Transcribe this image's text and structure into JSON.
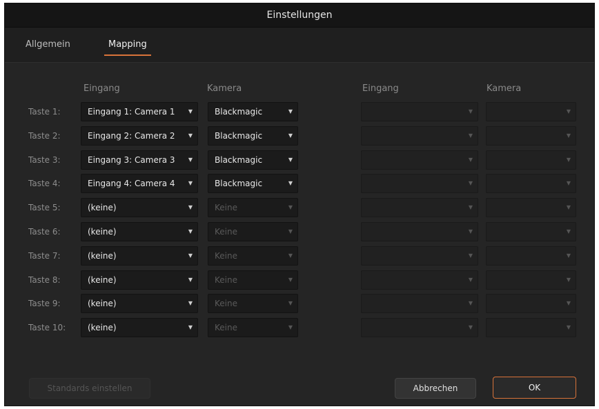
{
  "dialog": {
    "title": "Einstellungen"
  },
  "tabs": [
    {
      "label": "Allgemein",
      "active": false
    },
    {
      "label": "Mapping",
      "active": true
    }
  ],
  "columns": {
    "input": "Eingang",
    "camera": "Kamera"
  },
  "accent_color": "#d9733a",
  "rows": [
    {
      "label": "Taste 1:",
      "input": "Eingang 1: Camera 1",
      "camera": "Blackmagic",
      "camera_disabled": false
    },
    {
      "label": "Taste 2:",
      "input": "Eingang 2: Camera 2",
      "camera": "Blackmagic",
      "camera_disabled": false
    },
    {
      "label": "Taste 3:",
      "input": "Eingang 3: Camera 3",
      "camera": "Blackmagic",
      "camera_disabled": false
    },
    {
      "label": "Taste 4:",
      "input": "Eingang 4: Camera 4",
      "camera": "Blackmagic",
      "camera_disabled": false
    },
    {
      "label": "Taste 5:",
      "input": "(keine)",
      "camera": "Keine",
      "camera_disabled": true
    },
    {
      "label": "Taste 6:",
      "input": "(keine)",
      "camera": "Keine",
      "camera_disabled": true
    },
    {
      "label": "Taste 7:",
      "input": "(keine)",
      "camera": "Keine",
      "camera_disabled": true
    },
    {
      "label": "Taste 8:",
      "input": "(keine)",
      "camera": "Keine",
      "camera_disabled": true
    },
    {
      "label": "Taste 9:",
      "input": "(keine)",
      "camera": "Keine",
      "camera_disabled": true
    },
    {
      "label": "Taste 10:",
      "input": "(keine)",
      "camera": "Keine",
      "camera_disabled": true
    }
  ],
  "buttons": {
    "defaults": "Standards einstellen",
    "cancel": "Abbrechen",
    "ok": "OK"
  }
}
